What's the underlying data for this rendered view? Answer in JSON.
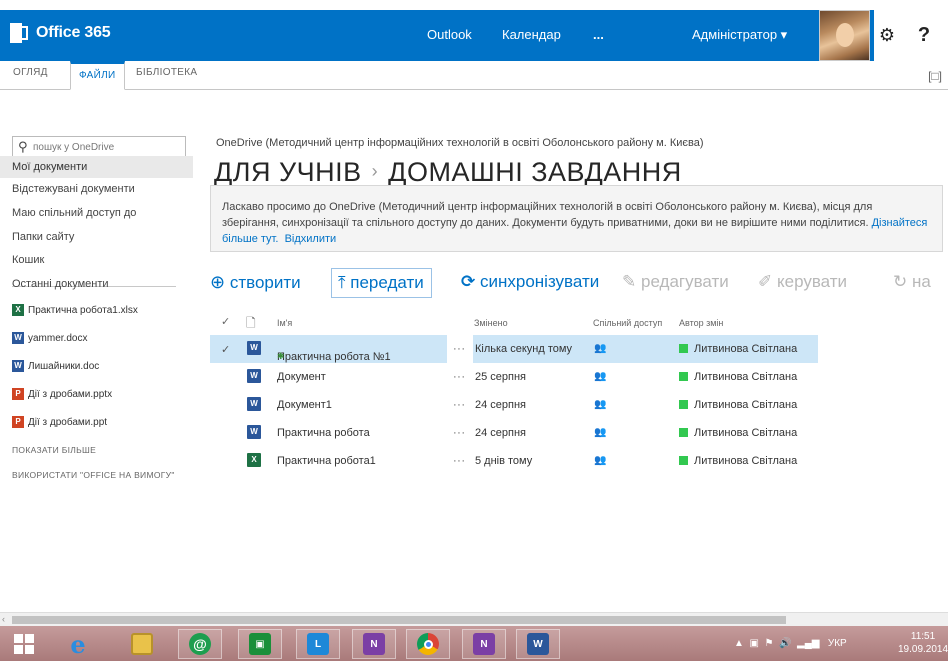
{
  "suite": {
    "brand": "Office 365",
    "nav": [
      "Outlook",
      "Календар",
      "...",
      "Адміністратор ▾"
    ],
    "settings_icon": "gear-icon",
    "help_label": "?"
  },
  "ribbon": {
    "tabs": [
      "ОГЛЯД",
      "ФАЙЛИ",
      "БІБЛІОТЕКА"
    ],
    "active_tab": "ФАЙЛИ"
  },
  "sidebar": {
    "search_placeholder": "пошук у OneDrive",
    "items": [
      "Мої документи",
      "Відстежувані документи",
      "Маю спільний доступ до",
      "Папки сайту",
      "Кошик"
    ],
    "recent_title": "Останні документи",
    "recent": [
      {
        "name": "Практична робота1.xlsx",
        "type": "x"
      },
      {
        "name": "yammer.docx",
        "type": "w"
      },
      {
        "name": "Лишайники.doc",
        "type": "w"
      },
      {
        "name": "Дії з дробами.pptx",
        "type": "p"
      },
      {
        "name": "Дії з дробами.ppt",
        "type": "p"
      }
    ],
    "show_more": "ПОКАЗАТИ БІЛЬШЕ",
    "use_office": "ВИКОРИСТАТИ \"OFFICE НА ВИМОГУ\""
  },
  "main": {
    "site_name": "OneDrive (Методичний центр інформаційних технологій в освіті Оболонського району м. Києва)",
    "breadcrumb": [
      "ДЛЯ УЧНІВ",
      "ДОМАШНІ ЗАВДАННЯ"
    ],
    "breadcrumb_sep": "›",
    "welcome_text": "Ласкаво просимо до OneDrive (Методичний центр інформаційних технологій в освіті Оболонського району м. Києва), місця для зберігання, синхронізації та спільного доступу до даних. Документи будуть приватними, доки ви не вирішите ними поділитися.",
    "learn_more": "Дізнайтеся більше тут.",
    "dismiss": "Відхилити",
    "commands": [
      "створити",
      "передати",
      "синхронізувати",
      "редагувати",
      "керувати",
      "на"
    ],
    "columns": [
      "Ім'я",
      "Змінено",
      "Спільний доступ",
      "Автор змін"
    ],
    "files": [
      {
        "name": "Практична робота №1",
        "modified": "Кілька секунд тому",
        "author": "Литвинова Світлана",
        "type": "w",
        "selected": true,
        "new": "✱"
      },
      {
        "name": "Документ",
        "modified": "25 серпня",
        "author": "Литвинова Світлана",
        "type": "w",
        "selected": false,
        "new": ""
      },
      {
        "name": "Документ1",
        "modified": "24 серпня",
        "author": "Литвинова Світлана",
        "type": "w",
        "selected": false,
        "new": ""
      },
      {
        "name": "Практична робота",
        "modified": "24 серпня",
        "author": "Литвинова Світлана",
        "type": "w",
        "selected": false,
        "new": ""
      },
      {
        "name": "Практична робота1",
        "modified": "5 днів тому",
        "author": "Литвинова Світлана",
        "type": "x",
        "selected": false,
        "new": ""
      }
    ]
  },
  "taskbar": {
    "apps": [
      "windows-logo-icon",
      "internet-explorer-icon",
      "file-explorer-icon",
      "email-icon",
      "store-icon",
      "lync-icon",
      "onenote-icon",
      "chrome-icon",
      "onenote-icon",
      "word-icon"
    ],
    "language": "УКР",
    "time": "11:51",
    "date": "19.09.2014"
  }
}
